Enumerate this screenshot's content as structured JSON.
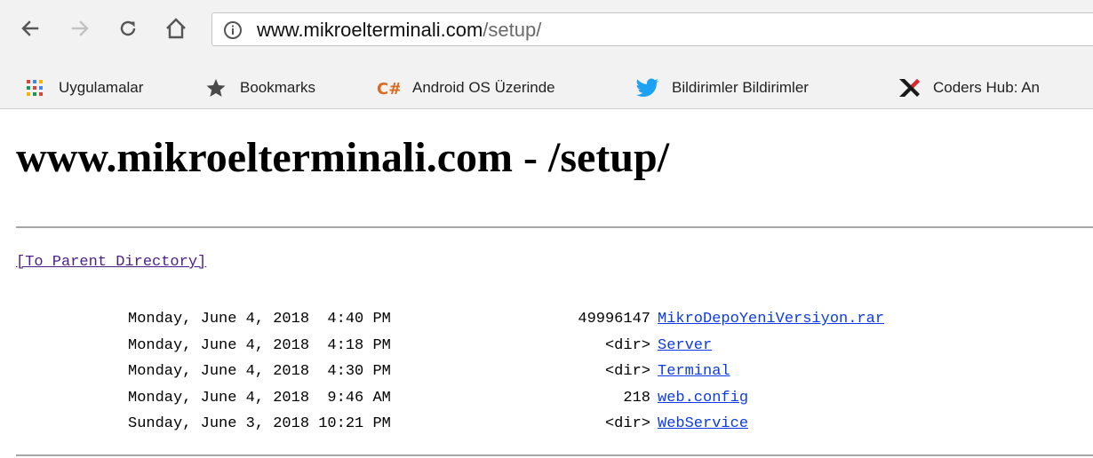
{
  "browser": {
    "url_host": "www.mikroelterminali.com",
    "url_path": "/setup/",
    "bookmarks": [
      {
        "label": "Uygulamalar",
        "icon": "apps-grid-icon"
      },
      {
        "label": "Bookmarks",
        "icon": "star-icon"
      },
      {
        "label": "Android OS Üzerinde",
        "icon": "csharp-icon"
      },
      {
        "label": "Bildirimler Bildirimler",
        "icon": "twitter-bird-icon"
      },
      {
        "label": "Coders Hub: An",
        "icon": "coders-hub-icon"
      }
    ]
  },
  "page": {
    "title": "www.mikroelterminali.com - /setup/",
    "parent_link": "[To Parent Directory]",
    "entries": [
      {
        "date": "Monday, June 4, 2018  4:40 PM",
        "size": "49996147",
        "name": "MikroDepoYeniVersiyon.rar"
      },
      {
        "date": "Monday, June 4, 2018  4:18 PM",
        "size": "<dir>",
        "name": "Server"
      },
      {
        "date": "Monday, June 4, 2018  4:30 PM",
        "size": "<dir>",
        "name": "Terminal"
      },
      {
        "date": "Monday, June 4, 2018  9:46 AM",
        "size": "218",
        "name": "web.config"
      },
      {
        "date": "Sunday, June 3, 2018 10:21 PM",
        "size": "<dir>",
        "name": "WebService"
      }
    ]
  },
  "colors": {
    "link_visited": "#4b1f8a",
    "link": "#0c3be6",
    "chrome_bg": "#f2f2f2"
  }
}
